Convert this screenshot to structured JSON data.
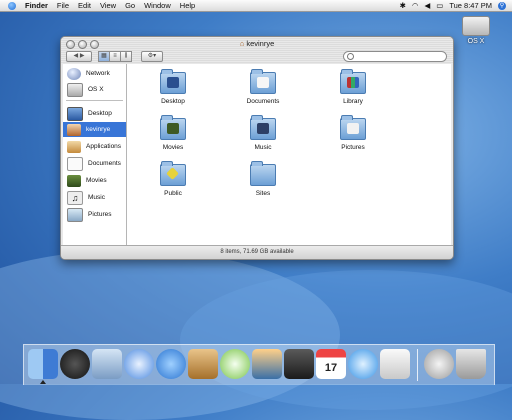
{
  "menubar": {
    "items": [
      "Finder",
      "File",
      "Edit",
      "View",
      "Go",
      "Window",
      "Help"
    ],
    "clock": "Tue 8:47 PM"
  },
  "desktop": {
    "disk_label": "OS X"
  },
  "window": {
    "title": "kevinrye",
    "search_placeholder": "",
    "status": "8 items, 71.69 GB available",
    "sidebar": {
      "devices": [
        {
          "label": "Network",
          "icon": "network-globe-icon"
        },
        {
          "label": "OS X",
          "icon": "hard-disk-icon"
        }
      ],
      "places": [
        {
          "label": "Desktop",
          "icon": "desktop-icon"
        },
        {
          "label": "kevinrye",
          "icon": "home-icon",
          "selected": true
        },
        {
          "label": "Applications",
          "icon": "applications-icon"
        },
        {
          "label": "Documents",
          "icon": "documents-icon"
        },
        {
          "label": "Movies",
          "icon": "movies-icon"
        },
        {
          "label": "Music",
          "icon": "music-icon"
        },
        {
          "label": "Pictures",
          "icon": "pictures-icon"
        }
      ]
    },
    "folders": [
      {
        "name": "Desktop",
        "icon": "desktop-folder-icon"
      },
      {
        "name": "Documents",
        "icon": "documents-folder-icon"
      },
      {
        "name": "Library",
        "icon": "library-folder-icon"
      },
      {
        "name": "Movies",
        "icon": "movies-folder-icon"
      },
      {
        "name": "Music",
        "icon": "music-folder-icon"
      },
      {
        "name": "Pictures",
        "icon": "pictures-folder-icon"
      },
      {
        "name": "Public",
        "icon": "public-folder-icon"
      },
      {
        "name": "Sites",
        "icon": "sites-folder-icon"
      }
    ]
  },
  "dock": {
    "apps": [
      "finder-icon",
      "dashboard-icon",
      "mail-icon",
      "safari-icon",
      "ichat-icon",
      "address-book-icon",
      "itunes-icon",
      "iphoto-icon",
      "imovie-icon",
      "ical-icon",
      "quicktime-icon",
      "preview-icon",
      "system-preferences-icon",
      "trash-icon"
    ],
    "ical_day": "17"
  }
}
